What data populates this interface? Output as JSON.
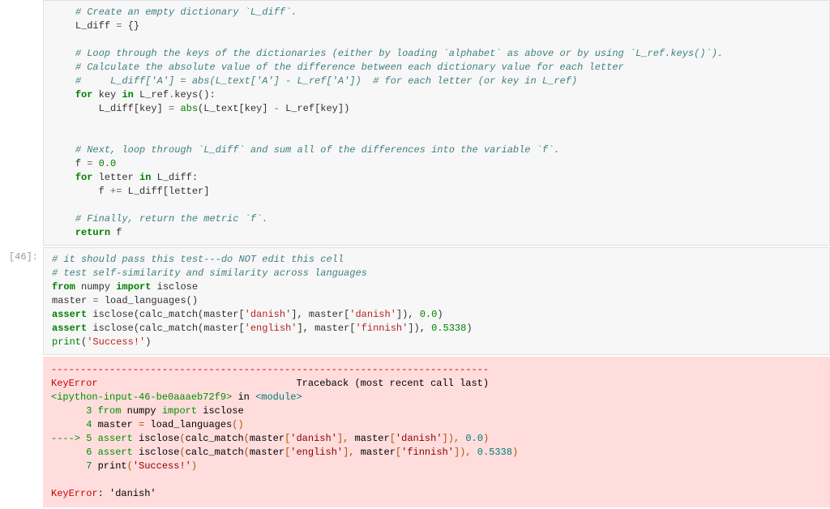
{
  "cell1": {
    "prompt": " ",
    "lines": {
      "indent": "    ",
      "l1_c": "# Create an empty dictionary `L_diff`.",
      "l2_a": "L_diff ",
      "l2_b": "=",
      "l2_c": " {}",
      "l3": "",
      "l4_c": "# Loop through the keys of the dictionaries (either by loading `alphabet` as above or by using `L_ref.keys()`).",
      "l5_c": "# Calculate the absolute value of the difference between each dictionary value for each letter",
      "l6_c": "#     L_diff['A'] = abs(L_text['A'] - L_ref['A'])  # for each letter (or key in L_ref)",
      "l7_a": "for",
      "l7_b": " key ",
      "l7_c": "in",
      "l7_d": " L_ref",
      "l7_e": ".",
      "l7_f": "keys",
      "l7_g": "():",
      "l8_a": "    L_diff[key] ",
      "l8_b": "=",
      "l8_c": " ",
      "l8_d": "abs",
      "l8_e": "(L_text[key] ",
      "l8_f": "-",
      "l8_g": " L_ref[key])",
      "l9": "",
      "l10": "",
      "l11_c": "# Next, loop through `L_diff` and sum all of the differences into the variable `f`.",
      "l12_a": "f ",
      "l12_b": "=",
      "l12_c": " ",
      "l12_d": "0.0",
      "l13_a": "for",
      "l13_b": " letter ",
      "l13_c": "in",
      "l13_d": " L_diff:",
      "l14_a": "    f ",
      "l14_b": "+=",
      "l14_c": " L_diff[letter]",
      "l15": "",
      "l16_c": "# Finally, return the metric `f`.",
      "l17_a": "return",
      "l17_b": " f"
    }
  },
  "cell2": {
    "prompt": "[46]:",
    "l1_c": "# it should pass this test---do NOT edit this cell",
    "l2_c": "# test self-similarity and similarity across languages",
    "l3_a": "from",
    "l3_b": " numpy ",
    "l3_c": "import",
    "l3_d": " isclose",
    "l4_a": "master ",
    "l4_b": "=",
    "l4_c": " load_languages()",
    "l5_a": "assert",
    "l5_b": " isclose(calc_match(master[",
    "l5_c": "'danish'",
    "l5_d": "], master[",
    "l5_e": "'danish'",
    "l5_f": "]), ",
    "l5_g": "0.0",
    "l5_h": ")",
    "l6_a": "assert",
    "l6_b": " isclose(calc_match(master[",
    "l6_c": "'english'",
    "l6_d": "], master[",
    "l6_e": "'finnish'",
    "l6_f": "]), ",
    "l6_g": "0.5338",
    "l6_h": ")",
    "l7_a": "print",
    "l7_b": "(",
    "l7_c": "'Success!'",
    "l7_d": ")"
  },
  "err": {
    "divider": "---------------------------------------------------------------------------",
    "e1_a": "KeyError",
    "e1_b": "                                  Traceback (most recent call last)",
    "e2_a": "<ipython-input-46-be0aaaeb72f9>",
    "e2_b": " in ",
    "e2_c": "<module>",
    "e3_a": "      3 ",
    "e3_b": "from",
    "e3_c": " numpy ",
    "e3_d": "import",
    "e3_e": " isclose",
    "e4_a": "      4 ",
    "e4_b": "master ",
    "e4_c": "=",
    "e4_d": " load_languages",
    "e4_e": "(",
    "e4_f": ")",
    "e5_a": "----> 5 ",
    "e5_b": "assert",
    "e5_c": " isclose",
    "e5_d": "(",
    "e5_e": "calc_match",
    "e5_f": "(",
    "e5_g": "master",
    "e5_h": "[",
    "e5_i": "'danish'",
    "e5_j": "],",
    "e5_k": " master",
    "e5_l": "[",
    "e5_m": "'danish'",
    "e5_n": "]),",
    "e5_o": " ",
    "e5_p": "0.0",
    "e5_q": ")",
    "e6_a": "      6 ",
    "e6_b": "assert",
    "e6_c": " isclose",
    "e6_d": "(",
    "e6_e": "calc_match",
    "e6_f": "(",
    "e6_g": "master",
    "e6_h": "[",
    "e6_i": "'english'",
    "e6_j": "],",
    "e6_k": " master",
    "e6_l": "[",
    "e6_m": "'finnish'",
    "e6_n": "]),",
    "e6_o": " ",
    "e6_p": "0.5338",
    "e6_q": ")",
    "e7_a": "      7 ",
    "e7_b": "print",
    "e7_c": "(",
    "e7_d": "'Success!'",
    "e7_e": ")",
    "blank": "",
    "e8_a": "KeyError",
    "e8_b": ": 'danish'"
  }
}
